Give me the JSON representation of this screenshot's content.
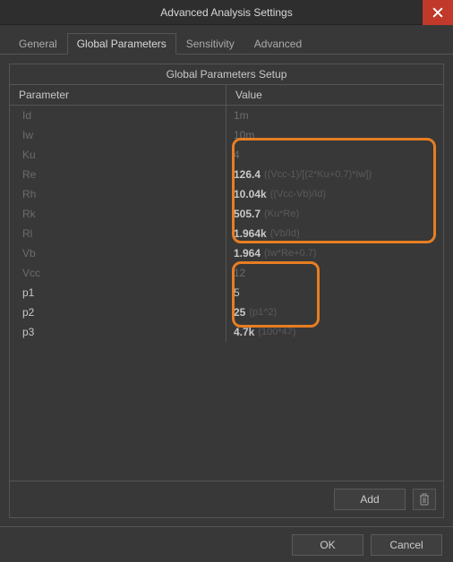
{
  "window": {
    "title": "Advanced Analysis Settings"
  },
  "tabs": {
    "general": "General",
    "global": "Global Parameters",
    "sensitivity": "Sensitivity",
    "advanced": "Advanced"
  },
  "panel": {
    "title": "Global Parameters Setup",
    "col_param": "Parameter",
    "col_value": "Value"
  },
  "rows": [
    {
      "param": "Id",
      "value": "1m",
      "expr": "",
      "dim": true,
      "bold": false
    },
    {
      "param": "Iw",
      "value": "10m",
      "expr": "",
      "dim": true,
      "bold": false
    },
    {
      "param": "Ku",
      "value": "4",
      "expr": "",
      "dim": true,
      "bold": false
    },
    {
      "param": "Re",
      "value": "126.4",
      "expr": "((Vcc-1)/[(2*Ku+0.7)*Iw])",
      "dim": true,
      "bold": true
    },
    {
      "param": "Rh",
      "value": "10.04k",
      "expr": "((Vcc-Vb)/Id)",
      "dim": true,
      "bold": true
    },
    {
      "param": "Rk",
      "value": "505.7",
      "expr": "(Ku*Re)",
      "dim": true,
      "bold": true
    },
    {
      "param": "Rl",
      "value": "1.964k",
      "expr": "(Vb/Id)",
      "dim": true,
      "bold": true
    },
    {
      "param": "Vb",
      "value": "1.964",
      "expr": "(Iw*Re+0.7)",
      "dim": true,
      "bold": true
    },
    {
      "param": "Vcc",
      "value": "12",
      "expr": "",
      "dim": true,
      "bold": false
    },
    {
      "param": "p1",
      "value": "5",
      "expr": "",
      "dim": false,
      "bold": false
    },
    {
      "param": "p2",
      "value": "25",
      "expr": "(p1^2)",
      "dim": false,
      "bold": true
    },
    {
      "param": "p3",
      "value": "4.7k",
      "expr": "(100*47)",
      "dim": false,
      "bold": true
    }
  ],
  "buttons": {
    "add": "Add",
    "ok": "OK",
    "cancel": "Cancel"
  }
}
